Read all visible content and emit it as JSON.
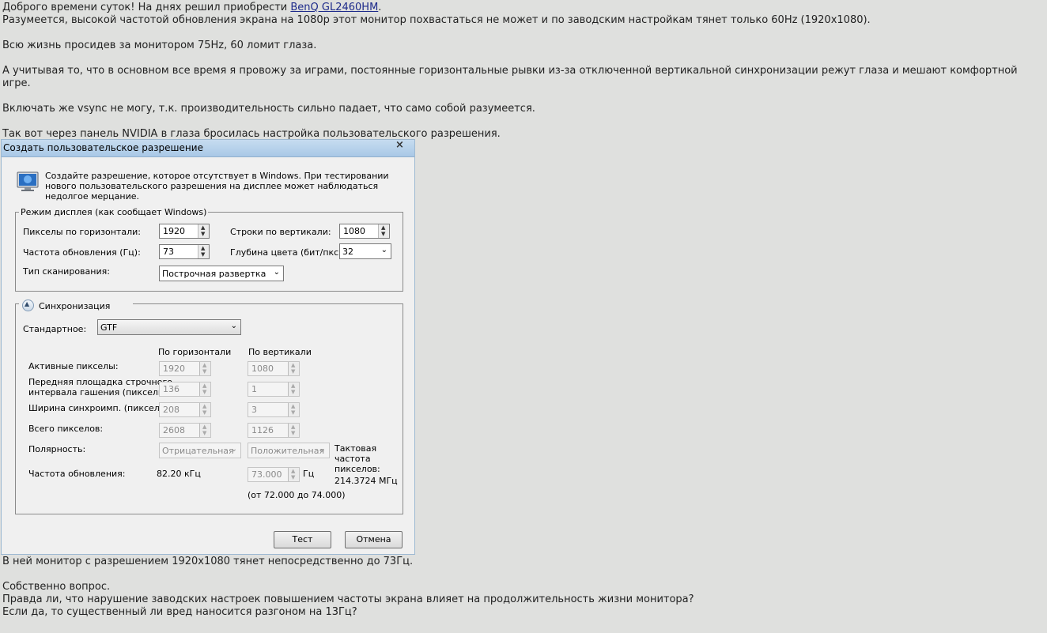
{
  "post": {
    "line1_prefix": "Доброго времени суток! На днях решил приобрести ",
    "line1_link": "BenQ GL2460HM",
    "line1_suffix": ".",
    "line2": "Разумеется, высокой частотой обновления экрана на 1080p этот монитор похвастаться не может и по заводским настройкам тянет только 60Hz (1920x1080).",
    "line3": "Всю жизнь просидев за монитором 75Hz, 60 ломит глаза.",
    "line4": "А учитывая то, что в основном все время я провожу за играми, постоянные горизонтальные рывки из-за отключенной вертикальной синхронизации режут глаза и мешают комфортной игре.",
    "line5": "Включать же vsync не могу, т.к. производительность сильно падает, что само собой разумеется.",
    "line6": "Так вот через панель NVIDIA в глаза бросилась настройка пользовательского разрешения.",
    "after1": "В ней монитор с разрешением 1920x1080 тянет непосредственно до 73Гц.",
    "after2": "Собственно вопрос.",
    "after3": "Правда ли, что нарушение заводских настроек повышением частоты экрана влияет на продолжительность жизни монитора?",
    "after4": "Если да, то существенный ли вред наносится разгоном на 13Гц?"
  },
  "dialog": {
    "title": "Создать пользовательское разрешение",
    "close": "×",
    "intro": "Создайте разрешение, которое отсутствует в Windows. При тестировании нового пользовательского разрешения на дисплее может наблюдаться недолгое мерцание.",
    "mode": {
      "legend": "Режим дисплея (как сообщает Windows)",
      "hpx_label": "Пикселы по горизонтали:",
      "hpx_value": "1920",
      "vlines_label": "Строки по вертикали:",
      "vlines_value": "1080",
      "refresh_label": "Частота обновления (Гц):",
      "refresh_value": "73",
      "depth_label": "Глубина цвета (бит/пкс):",
      "depth_value": "32",
      "scan_label": "Тип сканирования:",
      "scan_value": "Построчная развертка"
    },
    "sync": {
      "legend": "Синхронизация",
      "standard_label": "Стандартное:",
      "standard_value": "GTF",
      "col_h": "По горизонтали",
      "col_v": "По вертикали",
      "active_label": "Активные пикселы:",
      "active_h": "1920",
      "active_v": "1080",
      "front_label_1": "Передняя площадка строчного",
      "front_label_2": "интервала гашения (пикселы):",
      "front_h": "136",
      "front_v": "1",
      "width_label": "Ширина синхроимп. (пикселы):",
      "width_h": "208",
      "width_v": "3",
      "total_label": "Всего пикселов:",
      "total_h": "2608",
      "total_v": "1126",
      "polarity_label": "Полярность:",
      "polarity_h": "Отрицательная",
      "polarity_v": "Положительная",
      "pixclk_1": "Тактовая",
      "pixclk_2": "частота",
      "pixclk_3": "пикселов:",
      "pixclk_4": "214.3724 МГц",
      "refresh_label": "Частота обновления:",
      "refresh_h": "82.20 кГц",
      "refresh_v": "73.000",
      "refresh_unit": "Гц",
      "range": "(от 72.000 до 74.000)"
    },
    "buttons": {
      "test": "Тест",
      "cancel": "Отмена"
    }
  }
}
